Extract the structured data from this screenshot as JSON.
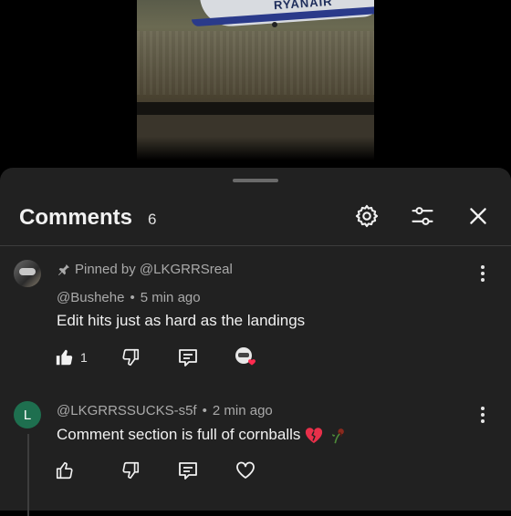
{
  "video": {
    "livery_text": "RYANAIR"
  },
  "sheet": {
    "title": "Comments",
    "count": "6",
    "icons": [
      "settings-gear-icon",
      "filter-sliders-icon",
      "close-icon"
    ]
  },
  "comments": [
    {
      "pinned_label": "Pinned by @LKGRRSreal",
      "author": "@Bushehe",
      "separator": "•",
      "time": "5 min ago",
      "text": "Edit hits just as hard as the landings",
      "likes": "1",
      "liked": true,
      "creator_heart": true
    },
    {
      "avatar_letter": "L",
      "avatar_color": "#1e6f4f",
      "author": "@LKGRRSSUCKS-s5f",
      "separator": "•",
      "time": "2 min ago",
      "text": "Comment section is full of cornballs",
      "emojis": [
        "broken-heart-icon",
        "wilted-rose-icon"
      ],
      "likes": "",
      "liked": false,
      "creator_heart": false
    }
  ]
}
